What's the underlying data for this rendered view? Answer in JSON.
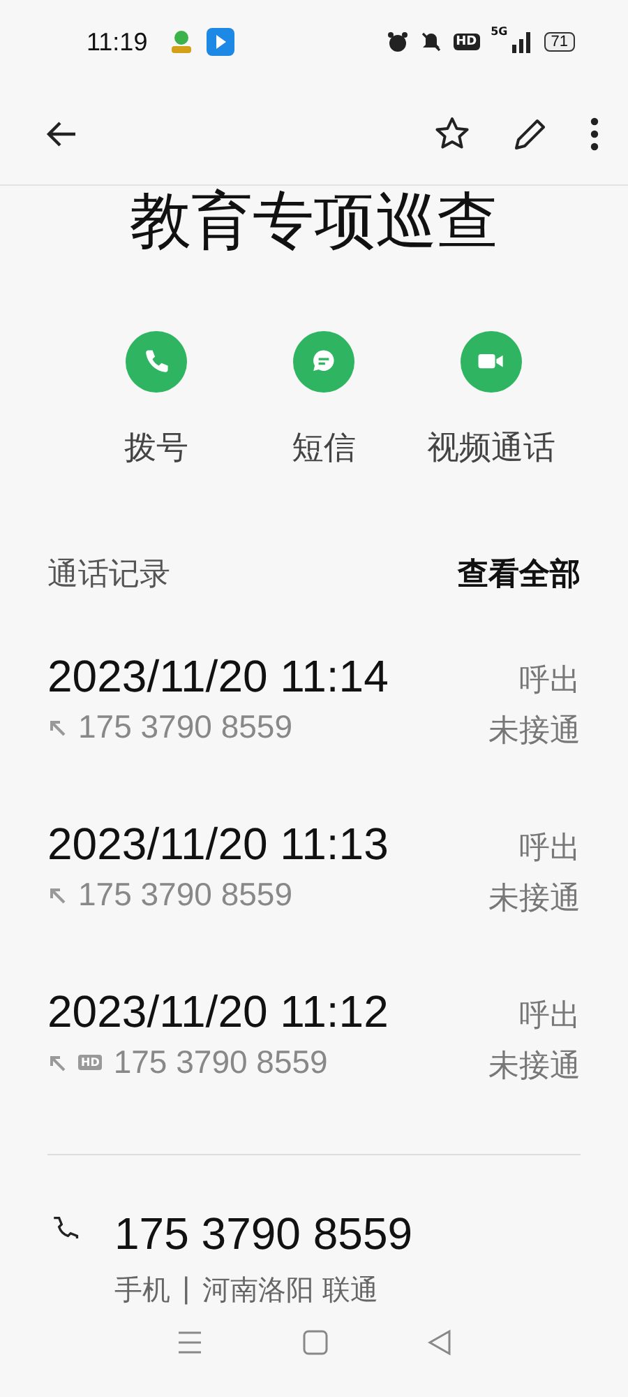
{
  "status_bar": {
    "time": "11:19",
    "hd": "HD",
    "network": "5G",
    "battery": "71"
  },
  "contact": {
    "name": "教育专项巡查"
  },
  "actions": [
    {
      "kind": "call",
      "label": "拨号"
    },
    {
      "kind": "message",
      "label": "短信"
    },
    {
      "kind": "video",
      "label": "视频通话"
    }
  ],
  "call_log": {
    "title": "通话记录",
    "view_all": "查看全部",
    "entries": [
      {
        "datetime": "2023/11/20 11:14",
        "number": "175 3790 8559",
        "type": "呼出",
        "status": "未接通"
      },
      {
        "datetime": "2023/11/20 11:13",
        "number": "175 3790 8559",
        "type": "呼出",
        "status": "未接通"
      },
      {
        "datetime": "2023/11/20 11:12",
        "badge": "HD",
        "number": "175 3790 8559",
        "type": "呼出",
        "status": "未接通"
      }
    ]
  },
  "phone": {
    "number": "175 3790 8559",
    "label": "手机",
    "separator": "|",
    "location": "河南洛阳 联通"
  }
}
